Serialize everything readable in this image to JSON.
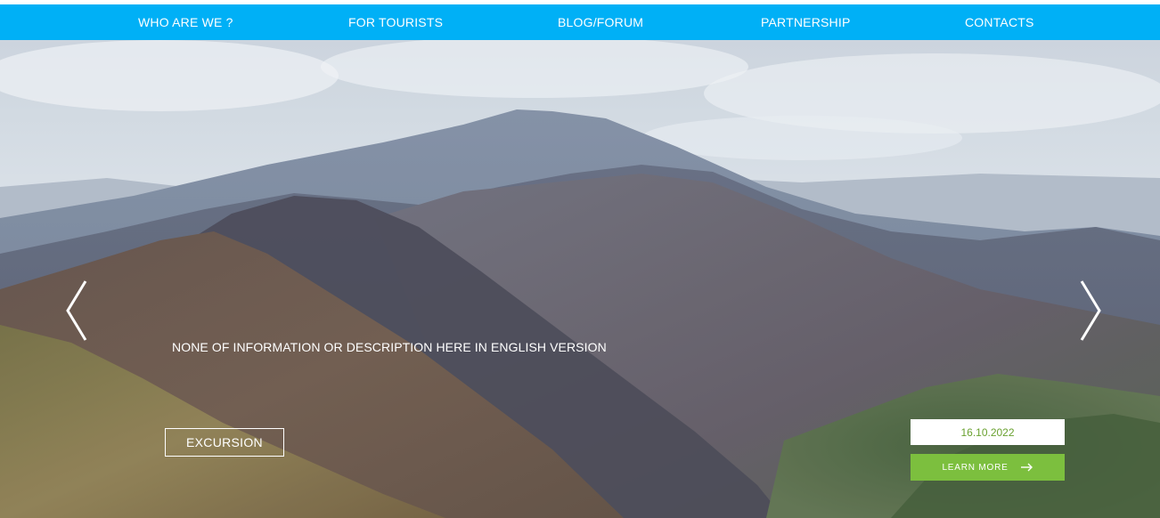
{
  "nav": {
    "items": [
      {
        "label": "WHO ARE WE ?"
      },
      {
        "label": "FOR TOURISTS"
      },
      {
        "label": "BLOG/FORUM"
      },
      {
        "label": "PARTNERSHIP"
      },
      {
        "label": "CONTACTS"
      }
    ]
  },
  "hero": {
    "description": "NONE OF INFORMATION OR DESCRIPTION HERE IN ENGLISH VERSION",
    "category_label": "EXCURSION",
    "date": "16.10.2022",
    "learn_more_label": "LEARN MORE",
    "prev_icon": "chevron-left-icon",
    "next_icon": "chevron-right-icon",
    "learn_more_icon": "arrow-right-icon"
  },
  "colors": {
    "nav_bg": "#00b0f6",
    "accent_green": "#7cbf3e",
    "date_text": "#6aa130"
  }
}
